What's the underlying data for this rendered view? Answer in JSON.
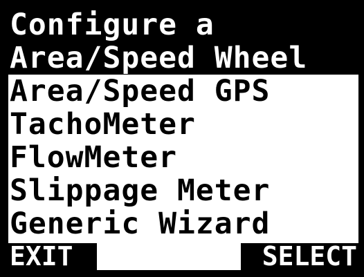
{
  "title": {
    "line1": "Configure a",
    "line2": "Area/Speed Wheel"
  },
  "menu": {
    "items": [
      {
        "label": "Area/Speed GPS",
        "selected": false
      },
      {
        "label": "TachoMeter",
        "selected": false
      },
      {
        "label": "FlowMeter",
        "selected": false
      },
      {
        "label": "Slippage Meter",
        "selected": false
      },
      {
        "label": "Generic Wizard",
        "selected": false
      }
    ]
  },
  "softkeys": {
    "left_label": "EXIT",
    "right_label": "SELECT"
  },
  "colors": {
    "foreground": "#000000",
    "background": "#ffffff"
  }
}
